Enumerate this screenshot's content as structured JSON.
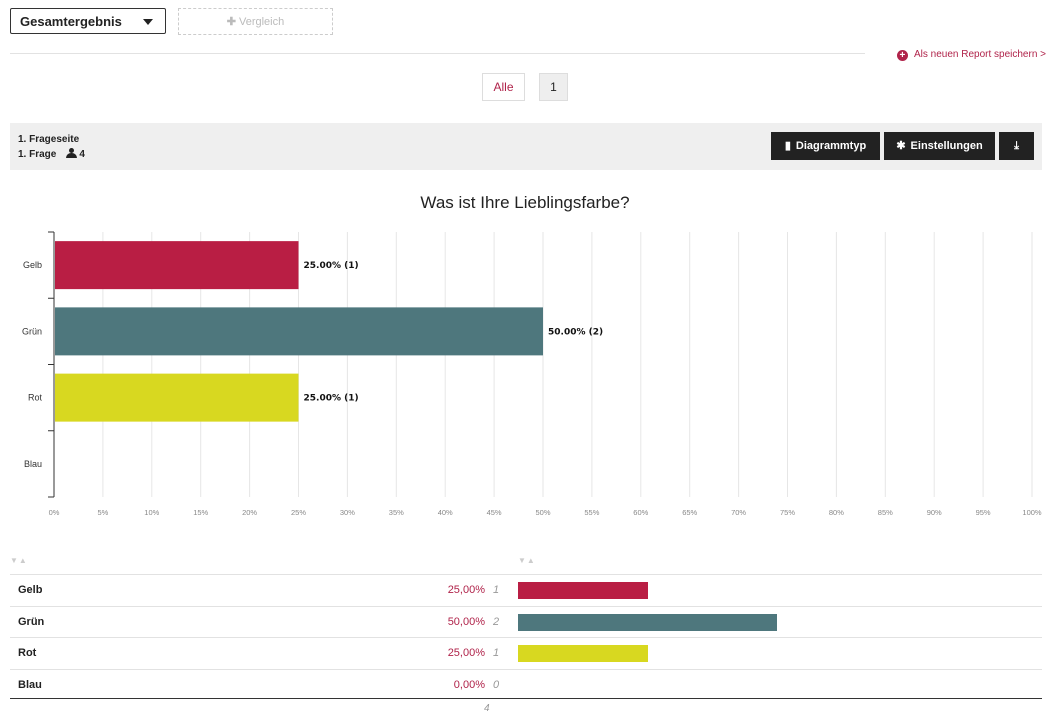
{
  "top": {
    "select_value": "Gesamtergebnis",
    "compare_label": "Vergleich",
    "save_report": "Als neuen Report speichern >"
  },
  "pagination": {
    "all": "Alle",
    "page": "1"
  },
  "question": {
    "page_label": "1. Frageseite",
    "question_label": "1. Frage",
    "respondents": "4",
    "buttons": {
      "chart_type": "Diagrammtyp",
      "settings": "Einstellungen"
    }
  },
  "chart_data": {
    "type": "bar",
    "orientation": "horizontal",
    "title": "Was ist Ihre Lieblingsfarbe?",
    "categories": [
      "Gelb",
      "Grün",
      "Rot",
      "Blau"
    ],
    "values": [
      25,
      50,
      25,
      0
    ],
    "counts": [
      1,
      2,
      1,
      0
    ],
    "value_labels": [
      "25.00% (1)",
      "50.00% (2)",
      "25.00% (1)",
      ""
    ],
    "colors": [
      "#b91e44",
      "#4e777d",
      "#d8d820",
      "#cccccc"
    ],
    "xlim": [
      0,
      100
    ],
    "xticks": [
      "0%",
      "5%",
      "10%",
      "15%",
      "20%",
      "25%",
      "30%",
      "35%",
      "40%",
      "45%",
      "50%",
      "55%",
      "60%",
      "65%",
      "70%",
      "75%",
      "80%",
      "85%",
      "90%",
      "95%",
      "100%"
    ],
    "grid": true
  },
  "table": {
    "rows": [
      {
        "label": "Gelb",
        "pct": "25,00%",
        "count": "1",
        "value": 25,
        "color": "#b91e44"
      },
      {
        "label": "Grün",
        "pct": "50,00%",
        "count": "2",
        "value": 50,
        "color": "#4e777d"
      },
      {
        "label": "Rot",
        "pct": "25,00%",
        "count": "1",
        "value": 25,
        "color": "#d8d820"
      },
      {
        "label": "Blau",
        "pct": "0,00%",
        "count": "0",
        "value": 0,
        "color": "#cccccc"
      }
    ],
    "total": "4"
  }
}
